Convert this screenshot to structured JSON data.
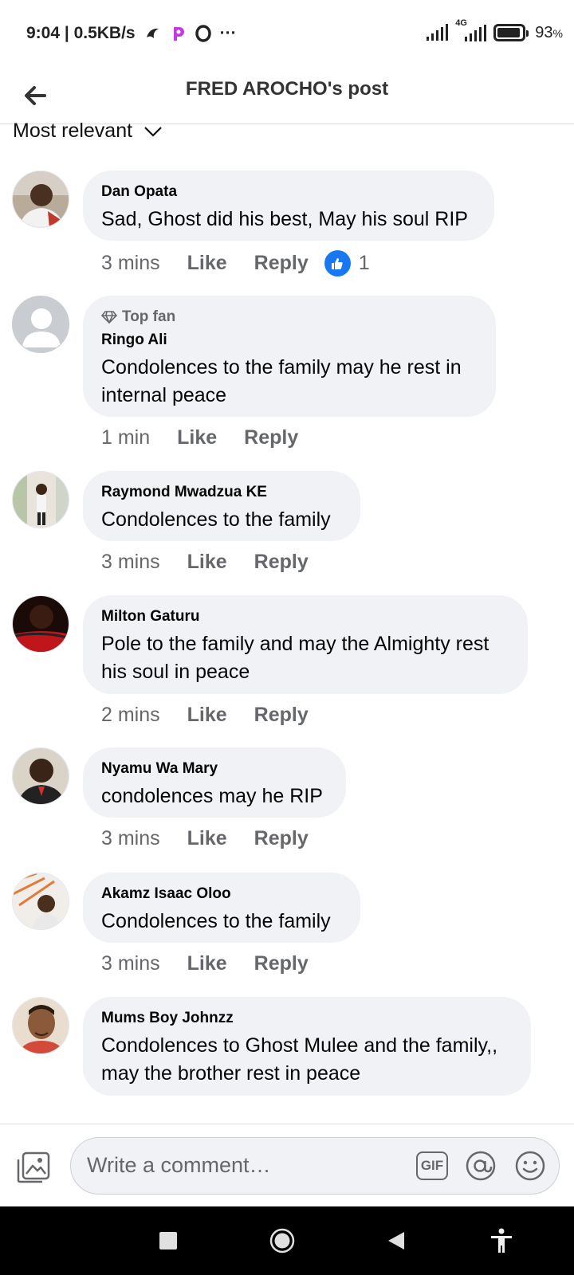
{
  "status_bar": {
    "time_speed": "9:04 | 0.5KB/s",
    "more": "···",
    "network": "4G",
    "battery": "93",
    "battery_unit": "%",
    "battery_level": 0.93
  },
  "header": {
    "title": "FRED AROCHO's post"
  },
  "sort": {
    "label": "Most relevant"
  },
  "comments": [
    {
      "author": "Dan Opata",
      "text": "Sad, Ghost did his best, May his soul RIP",
      "time": "3 mins",
      "like": "Like",
      "reply": "Reply",
      "reaction_count": "1"
    },
    {
      "badge": "Top fan",
      "author": "Ringo Ali",
      "text": "Condolences to the family may he rest in internal peace",
      "time": "1 min",
      "like": "Like",
      "reply": "Reply"
    },
    {
      "author": "Raymond Mwadzua KE",
      "text": "Condolences to the family",
      "time": "3 mins",
      "like": "Like",
      "reply": "Reply"
    },
    {
      "author": "Milton Gaturu",
      "text": "Pole to the family and may the Almighty rest his soul in peace",
      "time": "2 mins",
      "like": "Like",
      "reply": "Reply"
    },
    {
      "author": "Nyamu Wa Mary",
      "text": "condolences may he RIP",
      "time": "3 mins",
      "like": "Like",
      "reply": "Reply"
    },
    {
      "author": "Akamz Isaac Oloo",
      "text": "Condolences to the family",
      "time": "3 mins",
      "like": "Like",
      "reply": "Reply"
    },
    {
      "author": "Mums Boy Johnzz",
      "text": "Condolences to Ghost Mulee and the family,, may the brother rest in peace"
    }
  ],
  "composer": {
    "placeholder": "Write a comment…",
    "gif": "GIF"
  },
  "colors": {
    "accent": "#1877f2",
    "bubble": "#f0f2f5",
    "secondary_text": "#65676b"
  }
}
